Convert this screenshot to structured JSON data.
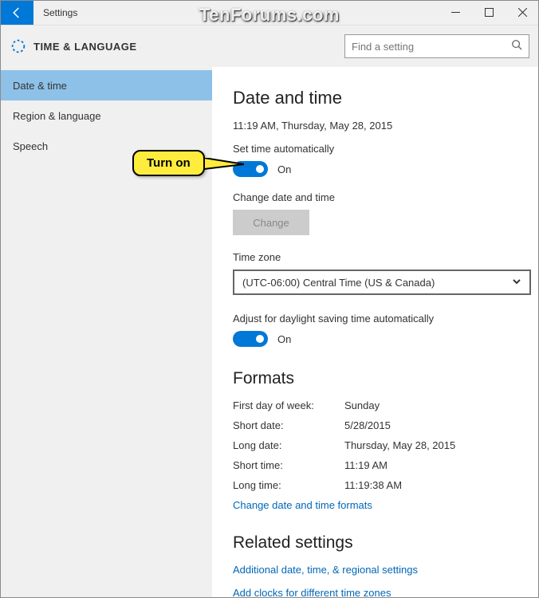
{
  "titlebar": {
    "title": "Settings"
  },
  "header": {
    "title": "TIME & LANGUAGE",
    "search_placeholder": "Find a setting"
  },
  "sidebar": {
    "items": [
      {
        "label": "Date & time",
        "active": true
      },
      {
        "label": "Region & language",
        "active": false
      },
      {
        "label": "Speech",
        "active": false
      }
    ]
  },
  "main": {
    "heading": "Date and time",
    "datetime_line": "11:19 AM, Thursday, May 28, 2015",
    "set_auto_label": "Set time automatically",
    "set_auto_state": "On",
    "change_label": "Change date and time",
    "change_btn": "Change",
    "tz_label": "Time zone",
    "tz_value": "(UTC-06:00) Central Time (US & Canada)",
    "dst_label": "Adjust for daylight saving time automatically",
    "dst_state": "On",
    "formats_heading": "Formats",
    "formats": [
      {
        "k": "First day of week:",
        "v": "Sunday"
      },
      {
        "k": "Short date:",
        "v": "5/28/2015"
      },
      {
        "k": "Long date:",
        "v": "Thursday, May 28, 2015"
      },
      {
        "k": "Short time:",
        "v": "11:19 AM"
      },
      {
        "k": "Long time:",
        "v": "11:19:38 AM"
      }
    ],
    "formats_link": "Change date and time formats",
    "related_heading": "Related settings",
    "related_links": [
      "Additional date, time, & regional settings",
      "Add clocks for different time zones"
    ]
  },
  "callout": {
    "text": "Turn on"
  },
  "watermark": "TenForums.com"
}
